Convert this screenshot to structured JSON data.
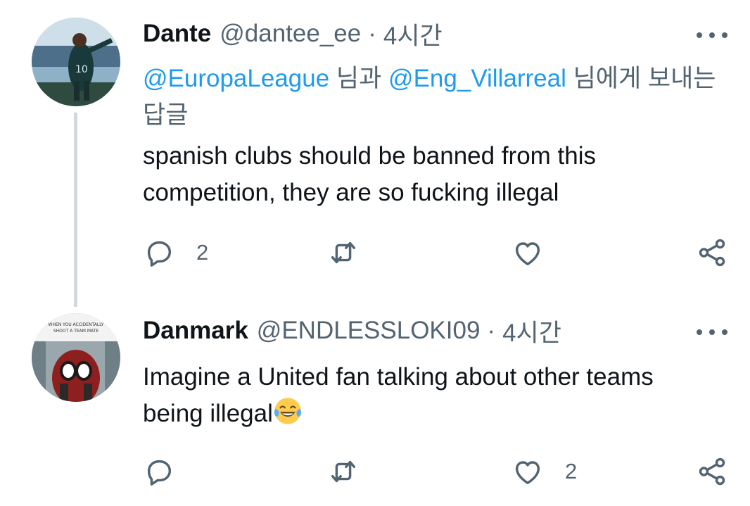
{
  "tweets": [
    {
      "display_name": "Dante",
      "handle": "@dantee_ee",
      "separator": "·",
      "time": "4시간",
      "reply_to": {
        "mention_1": "@EuropaLeague",
        "connector": " 님과 ",
        "mention_2": "@Eng_Villarreal",
        "suffix": " 님에게 보내는 답글"
      },
      "text": "spanish clubs should be banned from this competition, they are so fucking illegal",
      "reply_count": "2",
      "retweet_count": "",
      "like_count": ""
    },
    {
      "display_name": "Danmark",
      "handle": "@ENDLESSLOKI09",
      "separator": "·",
      "time": "4시간",
      "text_line_1": "Imagine a United fan talking about other teams",
      "text_line_2": "being illegal",
      "emoji": "face-with-tears-of-joy-emoji",
      "avatar_caption_1": "WHEN YOU ACCIDENTALLY",
      "avatar_caption_2": "SHOOT A TEAM MATE",
      "reply_count": "",
      "retweet_count": "",
      "like_count": "2"
    }
  ],
  "icons": [
    "more-icon",
    "reply-icon",
    "retweet-icon",
    "like-icon",
    "share-icon"
  ],
  "colors": {
    "text": "#0f1419",
    "secondary": "#536471",
    "link": "#1d9bf0",
    "thread_line": "#cfd9de"
  }
}
